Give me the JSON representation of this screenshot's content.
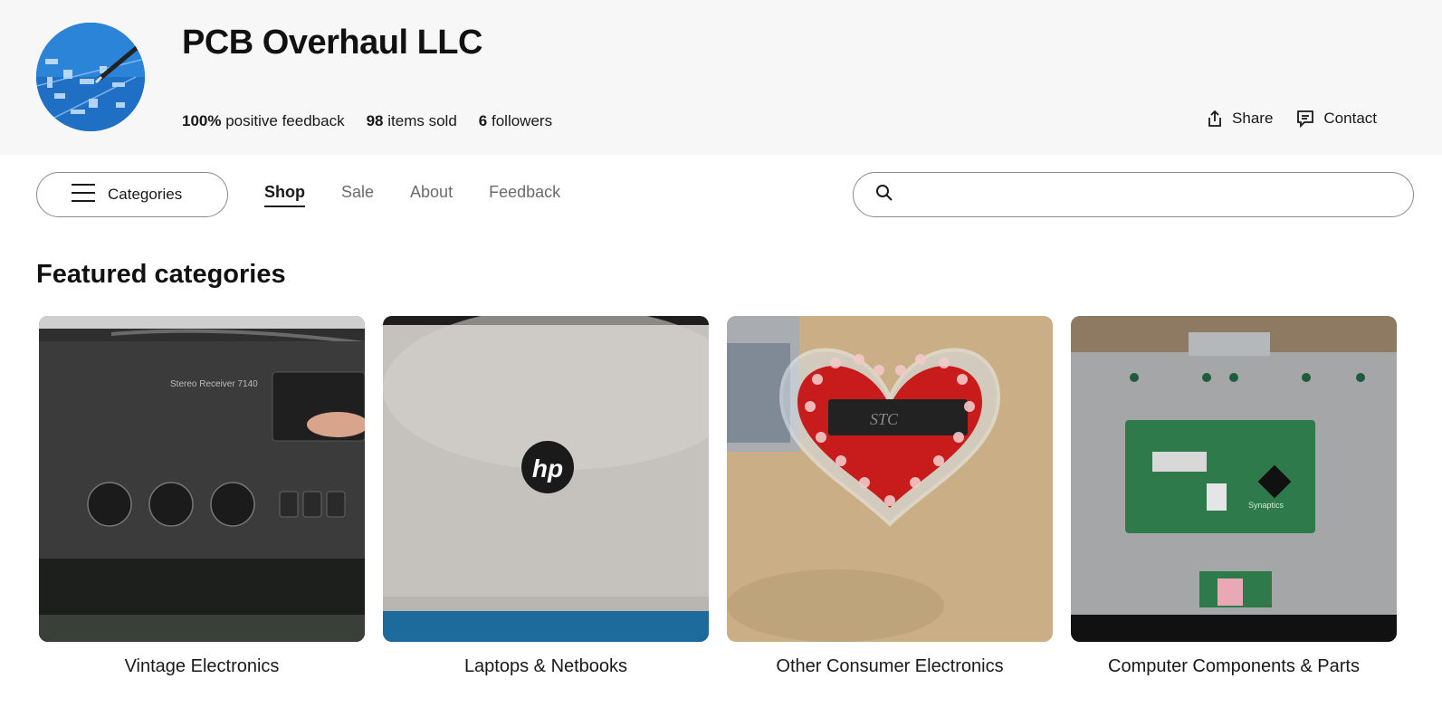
{
  "store": {
    "name": "PCB Overhaul LLC",
    "feedback_value": "100%",
    "feedback_label": "positive feedback",
    "sold_value": "98",
    "sold_label": "items sold",
    "followers_value": "6",
    "followers_label": "followers"
  },
  "actions": {
    "share": "Share",
    "contact": "Contact"
  },
  "nav": {
    "categories": "Categories",
    "tabs": [
      "Shop",
      "Sale",
      "About",
      "Feedback"
    ],
    "active_tab": "Shop"
  },
  "search": {
    "placeholder": "",
    "value": ""
  },
  "featured": {
    "title": "Featured categories",
    "items": [
      {
        "label": "Vintage Electronics",
        "image": "stereo-receiver-photo"
      },
      {
        "label": "Laptops & Netbooks",
        "image": "hp-laptop-lid-photo"
      },
      {
        "label": "Other Consumer Electronics",
        "image": "led-heart-kit-photo"
      },
      {
        "label": "Computer Components & Parts",
        "image": "touchpad-board-photo"
      }
    ]
  },
  "photo_text": {
    "receiver_model": "Stereo Receiver 7140",
    "laptop_logo": "hp",
    "chip_logo": "STC",
    "touchpad_brand": "Synaptics"
  },
  "icons": [
    "hamburger-menu-icon",
    "search-icon",
    "share-icon",
    "contact-icon"
  ]
}
